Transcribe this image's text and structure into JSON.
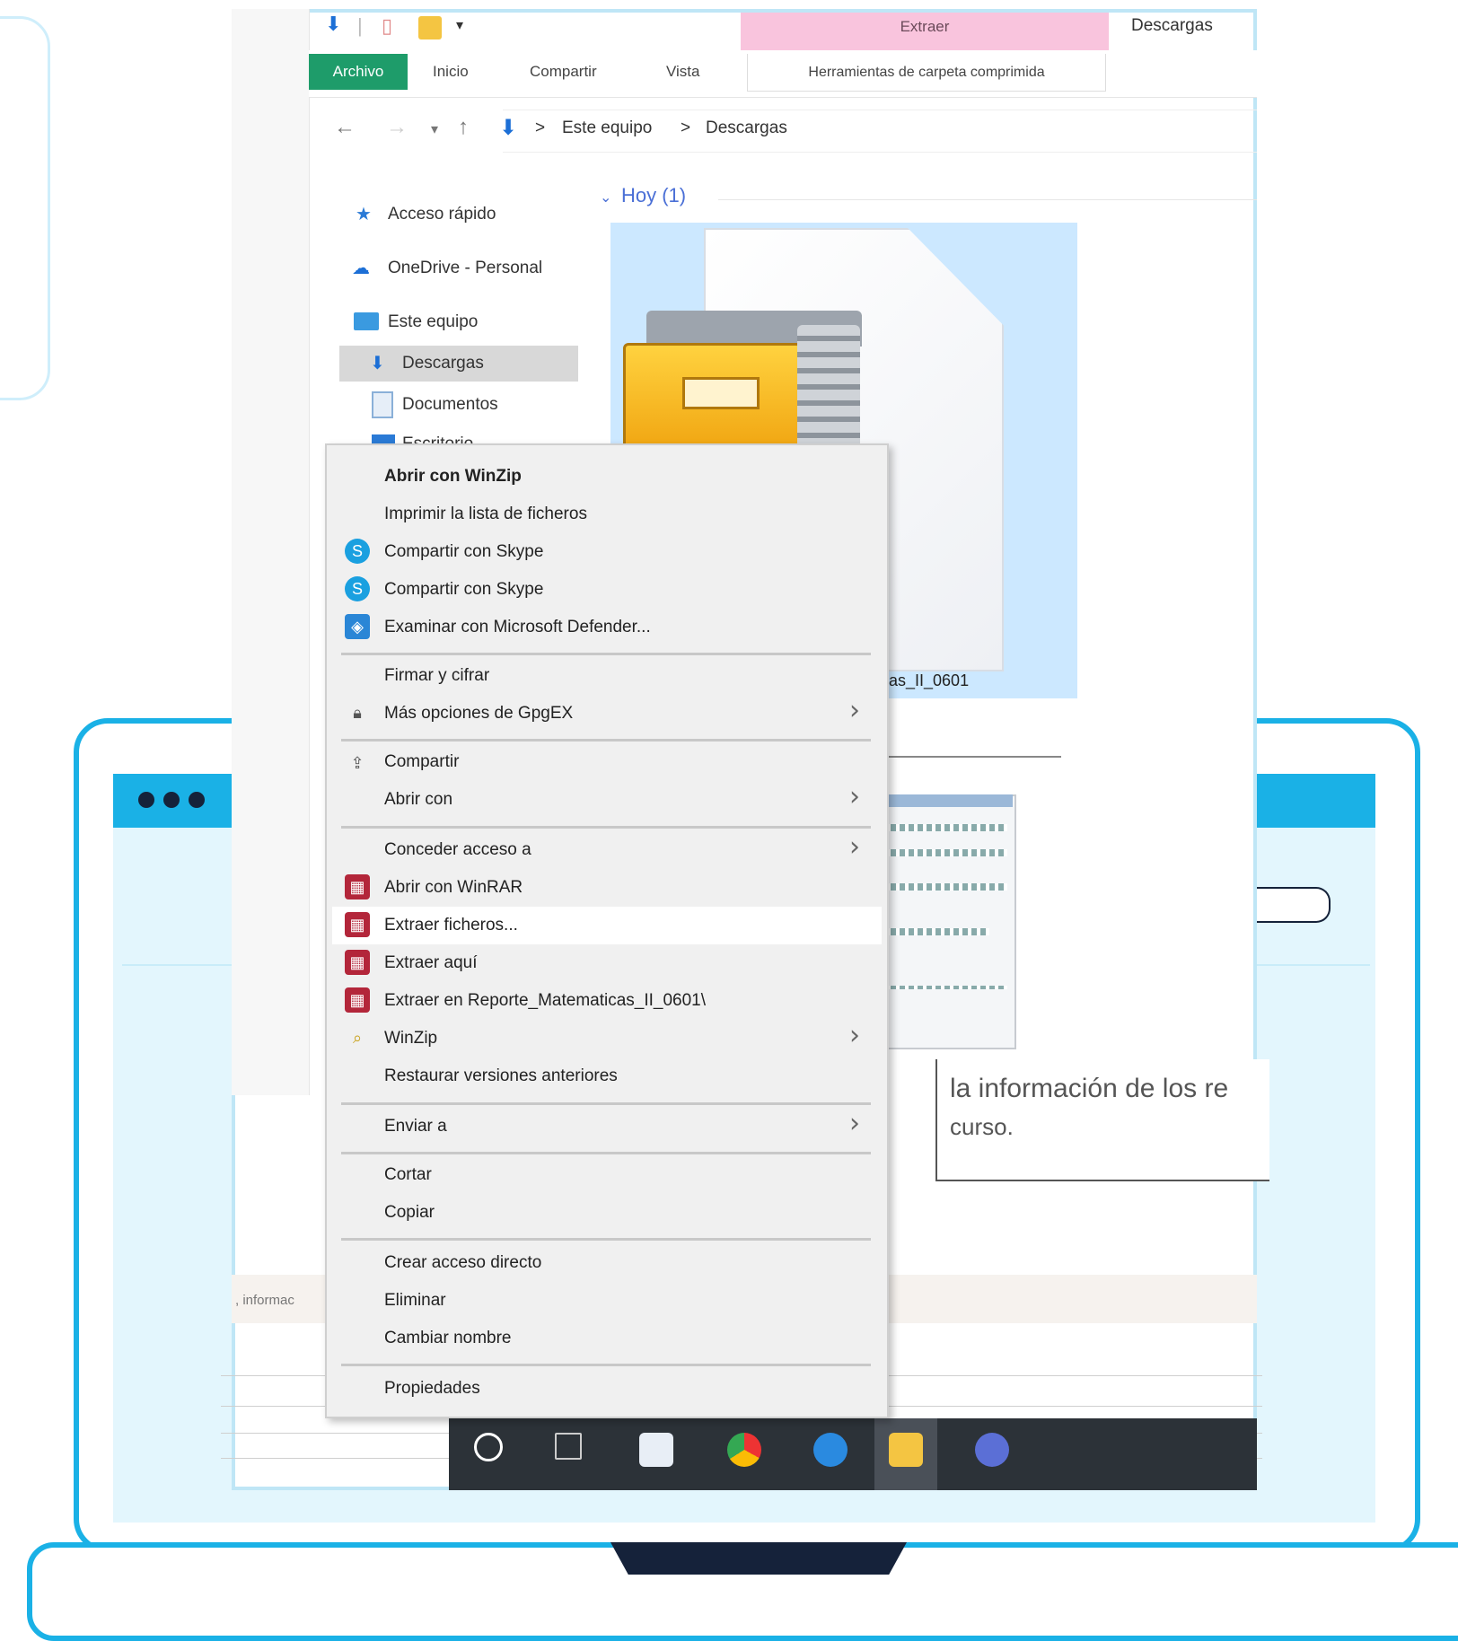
{
  "window": {
    "title": "Descargas",
    "contextual_tab": "Extraer",
    "tabs": [
      "Archivo",
      "Inicio",
      "Compartir",
      "Vista"
    ],
    "contextual_tab_tools": "Herramientas de carpeta comprimida"
  },
  "address": {
    "crumbs": [
      "Este equipo",
      "Descargas"
    ],
    "separator": ">"
  },
  "nav_pane": {
    "items": [
      {
        "label": "Acceso rápido",
        "icon": "star-icon"
      },
      {
        "label": "OneDrive - Personal",
        "icon": "cloud-icon"
      },
      {
        "label": "Este equipo",
        "icon": "computer-icon"
      },
      {
        "label": "Descargas",
        "icon": "download-icon",
        "selected": true
      },
      {
        "label": "Documentos",
        "icon": "document-icon"
      },
      {
        "label": "Escritorio",
        "icon": "desktop-icon"
      }
    ]
  },
  "content": {
    "group_header": "Hoy (1)",
    "file_name": "as_II_0601"
  },
  "preview": {
    "text_line1": "la información de los re",
    "text_line2": "curso.",
    "status_text": ", informac"
  },
  "context_menu": {
    "items": [
      {
        "label": "Abrir con WinZip",
        "bold": true
      },
      {
        "label": "Imprimir la lista de ficheros"
      },
      {
        "label": "Compartir con Skype",
        "icon": "skype-icon"
      },
      {
        "label": "Compartir con Skype",
        "icon": "skype-icon"
      },
      {
        "label": "Examinar con Microsoft Defender...",
        "icon": "defender-icon"
      },
      {
        "label": "Firmar y cifrar"
      },
      {
        "label": "Más opciones de GpgEX",
        "icon": "lock-icon",
        "submenu": true
      },
      {
        "label": "Compartir",
        "icon": "share-icon"
      },
      {
        "label": "Abrir con",
        "submenu": true
      },
      {
        "label": "Conceder acceso a",
        "submenu": true
      },
      {
        "label": "Abrir con WinRAR",
        "icon": "winrar-icon"
      },
      {
        "label": "Extraer ficheros...",
        "icon": "winrar-icon",
        "highlighted": true
      },
      {
        "label": "Extraer aquí",
        "icon": "winrar-icon"
      },
      {
        "label": "Extraer en Reporte_Matematicas_II_0601\\",
        "icon": "winrar-icon"
      },
      {
        "label": "WinZip",
        "icon": "winzip-icon",
        "submenu": true
      },
      {
        "label": "Restaurar versiones anteriores"
      },
      {
        "label": "Enviar a",
        "submenu": true
      },
      {
        "label": "Cortar"
      },
      {
        "label": "Copiar"
      },
      {
        "label": "Crear acceso directo"
      },
      {
        "label": "Eliminar"
      },
      {
        "label": "Cambiar nombre"
      },
      {
        "label": "Propiedades"
      }
    ]
  },
  "colors": {
    "accent": "#1ab1e6",
    "dark": "#15223a",
    "contextual_tab": "#f9c4dd",
    "archivo_tab": "#1e9c6a",
    "selection": "#cce8ff"
  }
}
